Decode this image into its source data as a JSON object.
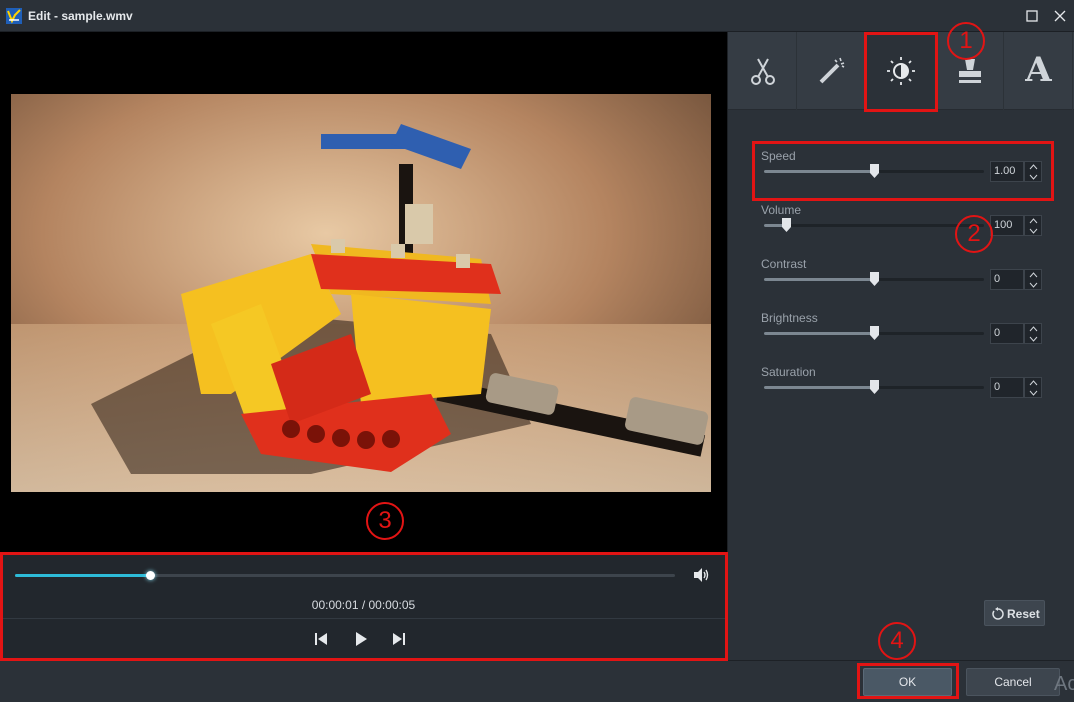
{
  "window": {
    "title": "Edit - sample.wmv"
  },
  "player": {
    "timecode": "00:00:01 / 00:00:05",
    "progress_fraction": 0.205
  },
  "tabs": [
    {
      "id": "trim",
      "icon": "scissors-icon"
    },
    {
      "id": "effects",
      "icon": "magic-wand-icon"
    },
    {
      "id": "adjust",
      "icon": "brightness-contrast-icon",
      "active": true
    },
    {
      "id": "watermark",
      "icon": "stamp-icon"
    },
    {
      "id": "text",
      "icon": "text-icon",
      "glyph": "A"
    }
  ],
  "adjustments": [
    {
      "label": "Speed",
      "value": "1.00",
      "level": 0.5
    },
    {
      "label": "Volume",
      "value": "100",
      "level": 0.1
    },
    {
      "label": "Contrast",
      "value": "0",
      "level": 0.5
    },
    {
      "label": "Brightness",
      "value": "0",
      "level": 0.5
    },
    {
      "label": "Saturation",
      "value": "0",
      "level": 0.5
    }
  ],
  "buttons": {
    "reset": "Reset",
    "ok": "OK",
    "cancel": "Cancel"
  },
  "annotations": [
    "1",
    "2",
    "3",
    "4"
  ],
  "overlay_text": "Ac",
  "colors": {
    "highlight": "#e21414",
    "seek_accent": "#2dbbd8"
  }
}
